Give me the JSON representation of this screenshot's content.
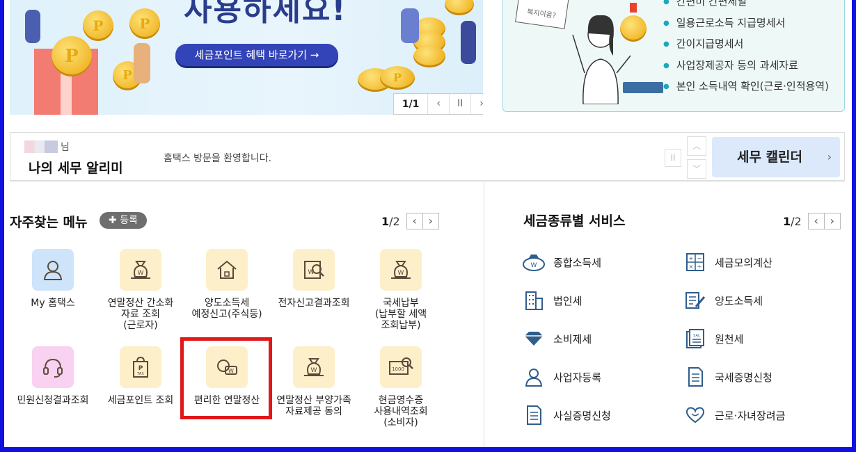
{
  "banner": {
    "headline": "사용하세요!",
    "button_label": "세금포인트 혜택 바로가기  →",
    "pager_count": "1/1",
    "prev": "‹",
    "pause": "II",
    "next": "›"
  },
  "info_panel": {
    "sticky_text": "복지이음?",
    "items": [
      "간편미 간편체일",
      "일용근로소득 지급명세서",
      "간이지급명세서",
      "사업장제공자 등의 과세자료",
      "본인 소득내역 확인(근로·인적용역)"
    ]
  },
  "alert_bar": {
    "user_suffix": "님",
    "title": "나의 세무 알리미",
    "message": "홈택스 방문을 환영합니다.",
    "pause": "II",
    "up": "︿",
    "down": "﹀",
    "calendar_label": "세무 캘린더",
    "calendar_arrow": "›"
  },
  "favorites": {
    "title": "자주찾는 메뉴",
    "register_label": "✚ 등록",
    "page_current": "1",
    "page_total": "/2",
    "prev": "‹",
    "next": "›",
    "tiles": [
      {
        "label": "My 홈택스",
        "icon": "user-icon"
      },
      {
        "label": "연말정산 간소화\n자료 조회\n(근로자)",
        "icon": "money-bag-icon"
      },
      {
        "label": "양도소득세\n예정신고(주식등)",
        "icon": "house-icon"
      },
      {
        "label": "전자신고결과조회",
        "icon": "document-search-icon"
      },
      {
        "label": "국세납부\n(납부할 세액\n조회납부)",
        "icon": "money-bag-icon"
      },
      {
        "label": "민원신청결과조회",
        "icon": "headset-icon"
      },
      {
        "label": "세금포인트 조회",
        "icon": "tax-bag-icon"
      },
      {
        "label": "편리한 연말정산",
        "icon": "won-chat-icon"
      },
      {
        "label": "연말정산 부양가족\n자료제공 동의",
        "icon": "money-bag-icon"
      },
      {
        "label": "현금영수증\n사용내역조회\n(소비자)",
        "icon": "receipt-search-icon"
      }
    ]
  },
  "tax_services": {
    "title": "세금종류별 서비스",
    "page_current": "1",
    "page_total": "/2",
    "prev": "‹",
    "next": "›",
    "items": [
      {
        "label": "종합소득세",
        "icon": "won-bag-icon"
      },
      {
        "label": "세금모의계산",
        "icon": "calculator-icon"
      },
      {
        "label": "법인세",
        "icon": "building-icon"
      },
      {
        "label": "양도소득세",
        "icon": "form-pen-icon"
      },
      {
        "label": "소비제세",
        "icon": "diamond-icon"
      },
      {
        "label": "원천세",
        "icon": "salary-doc-icon"
      },
      {
        "label": "사업자등록",
        "icon": "person-icon"
      },
      {
        "label": "국세증명신청",
        "icon": "certificate-icon"
      },
      {
        "label": "사실증명신청",
        "icon": "document-list-icon"
      },
      {
        "label": "근로·자녀장려금",
        "icon": "heart-hands-icon"
      }
    ]
  },
  "colors": {
    "frame": "#1010e0",
    "highlight": "#e01818",
    "banner_button": "#3344b8",
    "tile_bg": "#fdefc9",
    "icon_stroke": "#5b4a3a",
    "service_icon": "#2f5d8c"
  }
}
